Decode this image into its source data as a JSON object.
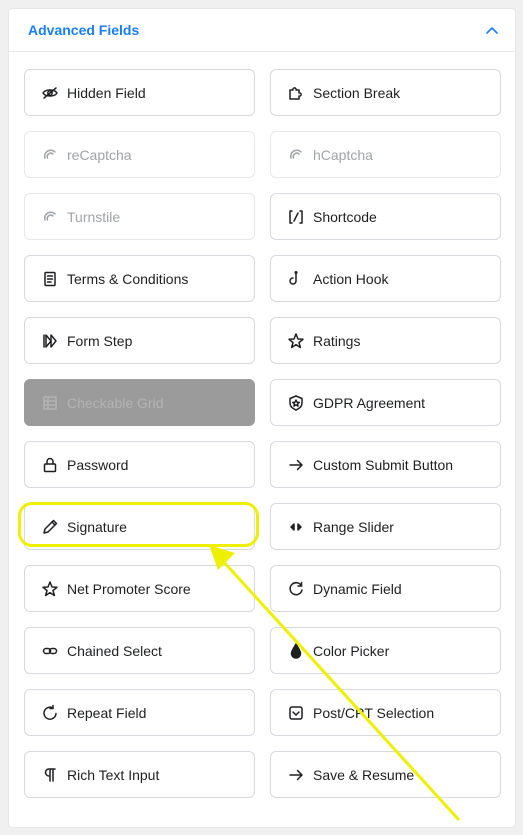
{
  "panel": {
    "title": "Advanced Fields",
    "collapse_icon": "chevron-up-icon",
    "accent_color": "#1a7efb"
  },
  "fields": [
    {
      "label": "Hidden Field",
      "icon": "eye-slash-icon",
      "state": "normal"
    },
    {
      "label": "Section Break",
      "icon": "puzzle-icon",
      "state": "normal"
    },
    {
      "label": "reCaptcha",
      "icon": "recaptcha-icon",
      "state": "disabled"
    },
    {
      "label": "hCaptcha",
      "icon": "hcaptcha-icon",
      "state": "disabled"
    },
    {
      "label": "Turnstile",
      "icon": "turnstile-icon",
      "state": "disabled"
    },
    {
      "label": "Shortcode",
      "icon": "shortcode-icon",
      "state": "normal"
    },
    {
      "label": "Terms & Conditions",
      "icon": "document-icon",
      "state": "normal"
    },
    {
      "label": "Action Hook",
      "icon": "hook-icon",
      "state": "normal"
    },
    {
      "label": "Form Step",
      "icon": "step-forward-icon",
      "state": "normal"
    },
    {
      "label": "Ratings",
      "icon": "star-icon",
      "state": "normal"
    },
    {
      "label": "Checkable Grid",
      "icon": "grid-icon",
      "state": "greyed"
    },
    {
      "label": "GDPR Agreement",
      "icon": "shield-icon",
      "state": "normal"
    },
    {
      "label": "Password",
      "icon": "lock-icon",
      "state": "normal"
    },
    {
      "label": "Custom Submit Button",
      "icon": "arrow-right-icon",
      "state": "normal"
    },
    {
      "label": "Signature",
      "icon": "pen-icon",
      "state": "normal"
    },
    {
      "label": "Range Slider",
      "icon": "range-icon",
      "state": "normal"
    },
    {
      "label": "Net Promoter Score",
      "icon": "star-outline-icon",
      "state": "normal"
    },
    {
      "label": "Dynamic Field",
      "icon": "refresh-icon",
      "state": "normal"
    },
    {
      "label": "Chained Select",
      "icon": "link-icon",
      "state": "normal"
    },
    {
      "label": "Color Picker",
      "icon": "drop-icon",
      "state": "normal"
    },
    {
      "label": "Repeat Field",
      "icon": "repeat-icon",
      "state": "normal"
    },
    {
      "label": "Post/CPT Selection",
      "icon": "post-icon",
      "state": "normal"
    },
    {
      "label": "Rich Text Input",
      "icon": "paragraph-icon",
      "state": "normal"
    },
    {
      "label": "Save & Resume",
      "icon": "arrow-right-icon",
      "state": "normal"
    }
  ],
  "annotation": {
    "highlighted_field": "Signature",
    "highlight_color": "#eef000"
  }
}
